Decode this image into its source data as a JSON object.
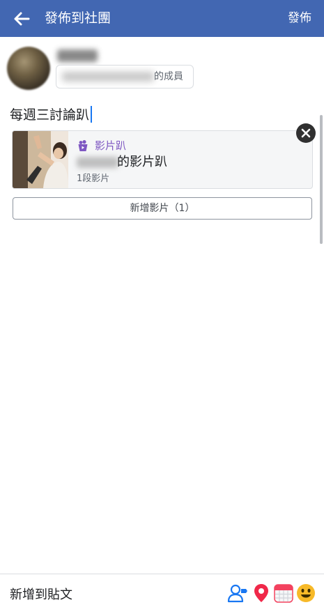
{
  "header": {
    "title": "發佈到社團",
    "post_label": "發佈",
    "back_icon": "back-arrow-icon",
    "background_color": "#4267b2"
  },
  "author": {
    "audience_suffix": "的成員"
  },
  "composer": {
    "text": "每週三討論趴"
  },
  "attachment": {
    "kind_label": "影片趴",
    "kind_icon": "party-cup-icon",
    "title_suffix": "的影片趴",
    "subtitle": "1段影片",
    "accent_color": "#7e57c2"
  },
  "add_video": {
    "label": "新增影片（1）"
  },
  "bottom_bar": {
    "label": "新增到貼文",
    "icons": [
      "tag-people-icon",
      "location-pin-icon",
      "event-calendar-icon",
      "feeling-emoji-icon"
    ]
  }
}
